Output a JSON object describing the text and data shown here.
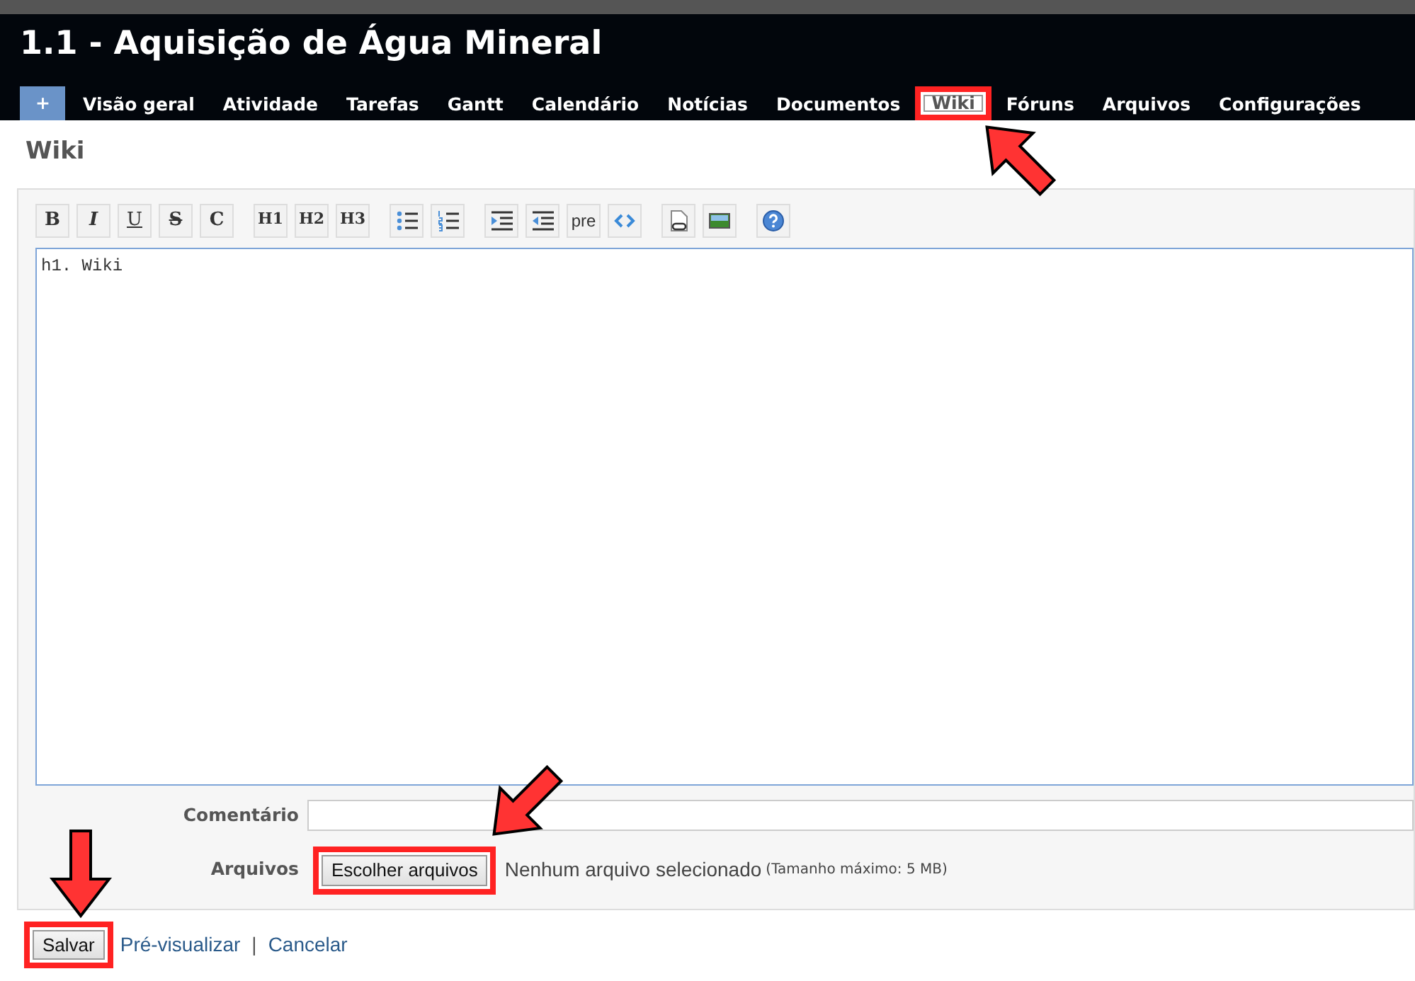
{
  "project": {
    "title": "1.1 - Aquisição de Água Mineral"
  },
  "tabs": [
    {
      "label": "+",
      "kind": "new",
      "selected": false,
      "highlighted": false
    },
    {
      "label": "Visão geral",
      "kind": "tab",
      "selected": false,
      "highlighted": false
    },
    {
      "label": "Atividade",
      "kind": "tab",
      "selected": false,
      "highlighted": false
    },
    {
      "label": "Tarefas",
      "kind": "tab",
      "selected": false,
      "highlighted": false
    },
    {
      "label": "Gantt",
      "kind": "tab",
      "selected": false,
      "highlighted": false
    },
    {
      "label": "Calendário",
      "kind": "tab",
      "selected": false,
      "highlighted": false
    },
    {
      "label": "Notícias",
      "kind": "tab",
      "selected": false,
      "highlighted": false
    },
    {
      "label": "Documentos",
      "kind": "tab",
      "selected": false,
      "highlighted": false
    },
    {
      "label": "Wiki",
      "kind": "tab",
      "selected": true,
      "highlighted": true,
      "arrow": true
    },
    {
      "label": "Fóruns",
      "kind": "tab",
      "selected": false,
      "highlighted": false
    },
    {
      "label": "Arquivos",
      "kind": "tab",
      "selected": false,
      "highlighted": false
    },
    {
      "label": "Configurações",
      "kind": "tab",
      "selected": false,
      "highlighted": false
    }
  ],
  "page_heading": "Wiki",
  "toolbar": [
    [
      {
        "kind": "bold",
        "label": "B"
      },
      {
        "kind": "italic",
        "label": "I"
      },
      {
        "kind": "underline",
        "label": "U"
      },
      {
        "kind": "strike",
        "label": "S"
      },
      {
        "kind": "bold",
        "label": "C"
      }
    ],
    [
      {
        "kind": "heading",
        "label": "H1"
      },
      {
        "kind": "heading",
        "label": "H2"
      },
      {
        "kind": "heading",
        "label": "H3"
      }
    ],
    [
      {
        "kind": "bullet-list"
      },
      {
        "kind": "numbered-list"
      }
    ],
    [
      {
        "kind": "indent"
      },
      {
        "kind": "outdent"
      },
      {
        "kind": "pre",
        "label": "pre"
      },
      {
        "kind": "code"
      }
    ],
    [
      {
        "kind": "link"
      },
      {
        "kind": "image"
      }
    ],
    [
      {
        "kind": "help"
      }
    ]
  ],
  "editor": {
    "value": "h1. Wiki"
  },
  "comment": {
    "label": "Comentário"
  },
  "files": {
    "label": "Arquivos",
    "button": {
      "label": "Escolher arquivos",
      "highlighted": true,
      "arrow": true
    },
    "status": "Nenhum arquivo selecionado",
    "note": "(Tamanho máximo: 5 MB)"
  },
  "actions": {
    "save": {
      "label": "Salvar",
      "highlighted": true,
      "arrow": true
    },
    "links": [
      "Pré-visualizar",
      "Cancelar"
    ],
    "separator": "|"
  }
}
